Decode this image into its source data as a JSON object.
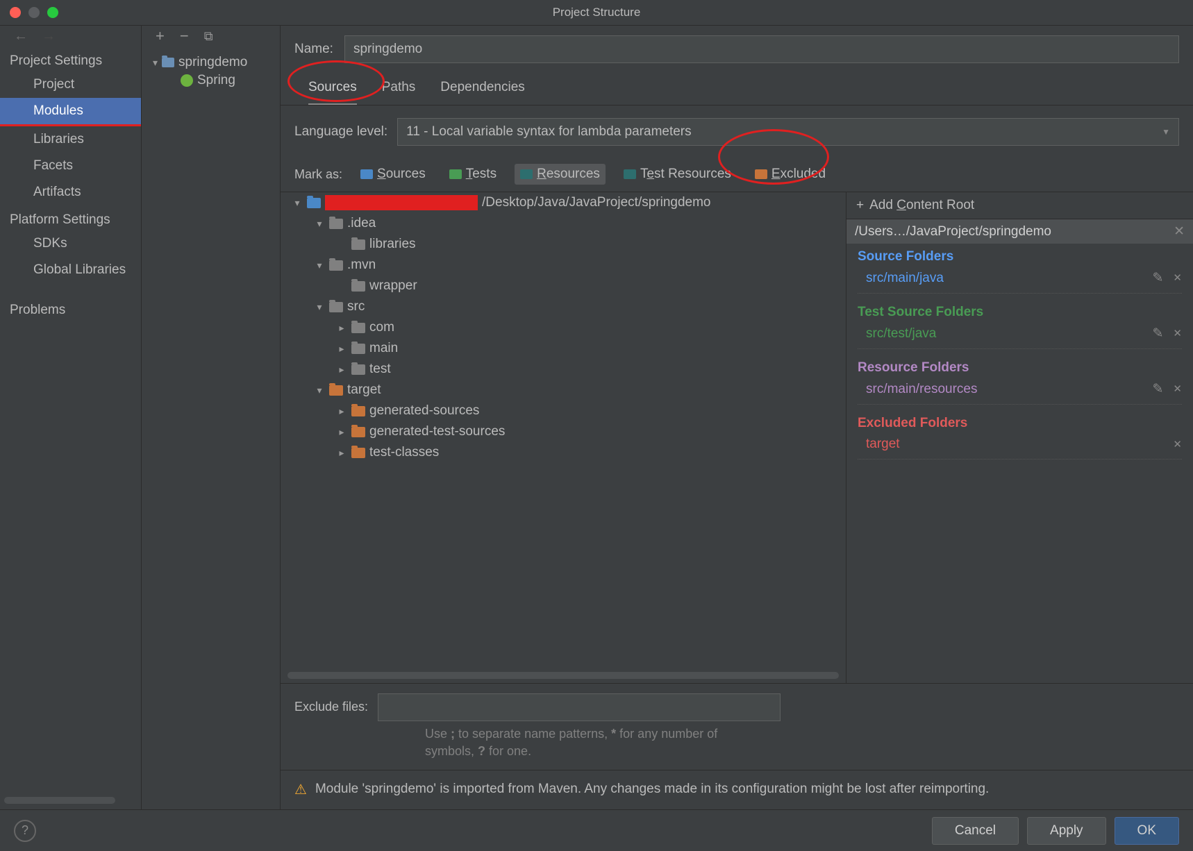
{
  "window": {
    "title": "Project Structure"
  },
  "nav": {
    "section1": "Project Settings",
    "items1": [
      "Project",
      "Modules",
      "Libraries",
      "Facets",
      "Artifacts"
    ],
    "section2": "Platform Settings",
    "items2": [
      "SDKs",
      "Global Libraries"
    ],
    "problems": "Problems"
  },
  "modtree": {
    "root": "springdemo",
    "child": "Spring"
  },
  "form": {
    "name_label": "Name:",
    "name_value": "springdemo",
    "tabs": [
      "Sources",
      "Paths",
      "Dependencies"
    ],
    "lang_label": "Language level:",
    "lang_value": "11 - Local variable syntax for lambda parameters",
    "mark_label": "Mark as:",
    "marks": [
      "Sources",
      "Tests",
      "Resources",
      "Test Resources",
      "Excluded"
    ]
  },
  "tree": {
    "root_path": "/Desktop/Java/JavaProject/springdemo",
    "nodes": [
      {
        "d": 1,
        "t": "down",
        "c": "grey",
        "l": ".idea"
      },
      {
        "d": 2,
        "t": "none",
        "c": "grey",
        "l": "libraries"
      },
      {
        "d": 1,
        "t": "down",
        "c": "grey",
        "l": ".mvn"
      },
      {
        "d": 2,
        "t": "none",
        "c": "grey",
        "l": "wrapper"
      },
      {
        "d": 1,
        "t": "down",
        "c": "grey",
        "l": "src"
      },
      {
        "d": 2,
        "t": "right",
        "c": "grey",
        "l": "com"
      },
      {
        "d": 2,
        "t": "right",
        "c": "grey",
        "l": "main"
      },
      {
        "d": 2,
        "t": "right",
        "c": "grey",
        "l": "test"
      },
      {
        "d": 1,
        "t": "down",
        "c": "orange",
        "l": "target"
      },
      {
        "d": 2,
        "t": "right",
        "c": "orange",
        "l": "generated-sources"
      },
      {
        "d": 2,
        "t": "right",
        "c": "orange",
        "l": "generated-test-sources"
      },
      {
        "d": 2,
        "t": "right",
        "c": "orange",
        "l": "test-classes"
      }
    ]
  },
  "roots": {
    "add": "Add Content Root",
    "path": "/Users…/JavaProject/springdemo",
    "sections": [
      {
        "title": "Source Folders",
        "color": "t-blue",
        "items": [
          "src/main/java"
        ],
        "edit": true
      },
      {
        "title": "Test Source Folders",
        "color": "t-green",
        "items": [
          "src/test/java"
        ],
        "edit": true
      },
      {
        "title": "Resource Folders",
        "color": "t-purple",
        "items": [
          "src/main/resources"
        ],
        "edit": true
      },
      {
        "title": "Excluded Folders",
        "color": "t-red",
        "items": [
          "target"
        ],
        "edit": false
      }
    ]
  },
  "exclude": {
    "label": "Exclude files:",
    "hint": "Use ; to separate name patterns, * for any number of symbols, ? for one."
  },
  "warning": "Module 'springdemo' is imported from Maven. Any changes made in its configuration might be lost after reimporting.",
  "buttons": {
    "cancel": "Cancel",
    "apply": "Apply",
    "ok": "OK"
  }
}
